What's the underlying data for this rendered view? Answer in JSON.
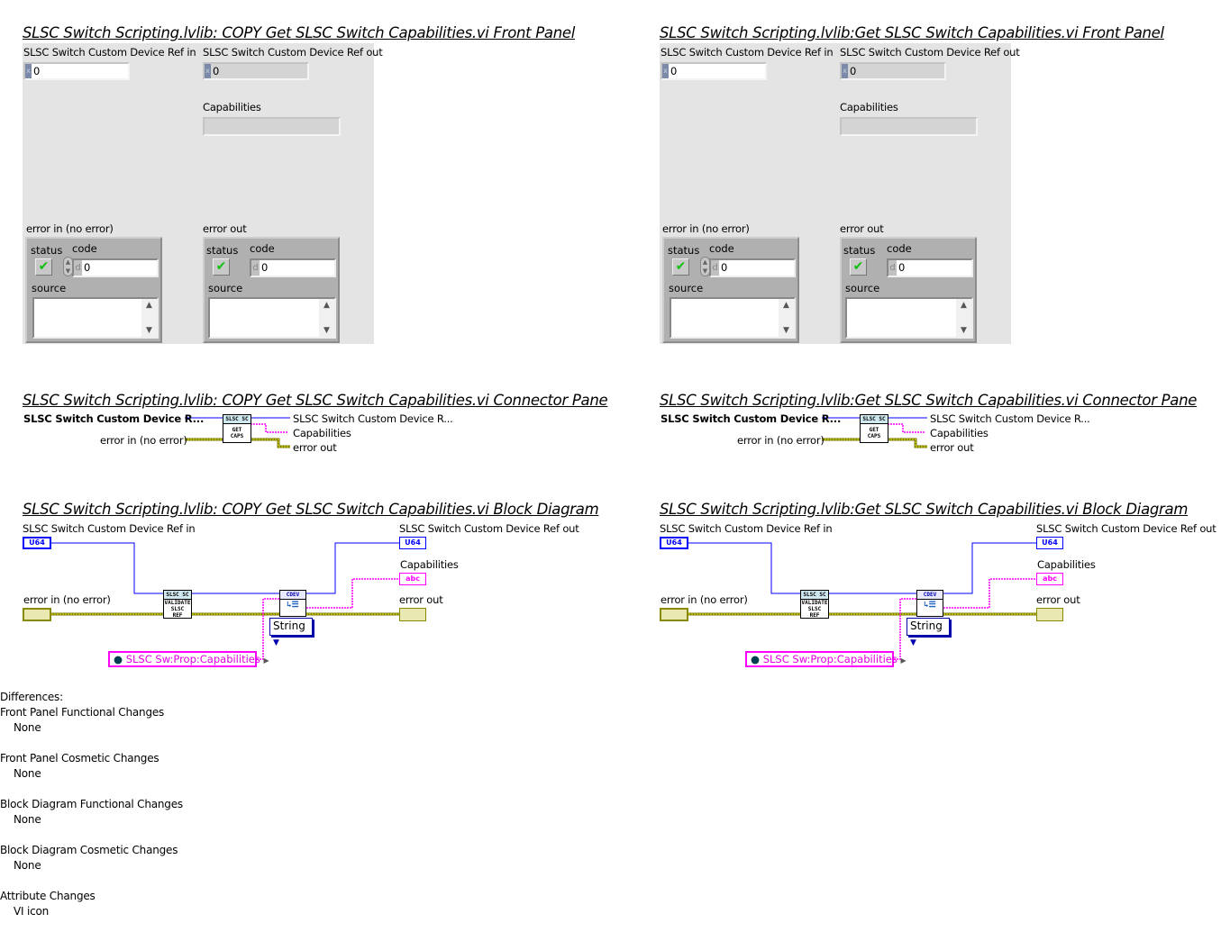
{
  "left": {
    "front_panel_title": "SLSC Switch Scripting.lvlib:  COPY  Get SLSC Switch Capabilities.vi Front Panel",
    "connector_pane_title": "SLSC Switch Scripting.lvlib:  COPY  Get SLSC Switch Capabilities.vi Connector Pane",
    "block_diagram_title": "SLSC Switch Scripting.lvlib:  COPY  Get SLSC Switch Capabilities.vi Block Diagram"
  },
  "right": {
    "front_panel_title": "SLSC Switch Scripting.lvlib:Get SLSC Switch Capabilities.vi Front Panel",
    "connector_pane_title": "SLSC Switch Scripting.lvlib:Get SLSC Switch Capabilities.vi Connector Pane",
    "block_diagram_title": "SLSC Switch Scripting.lvlib:Get SLSC Switch Capabilities.vi Block Diagram"
  },
  "front_panel": {
    "ref_in_label": "SLSC Switch Custom Device Ref in",
    "ref_in_value": "0",
    "ref_out_label": "SLSC Switch Custom Device Ref out",
    "ref_out_value": "0",
    "radix_glyph": "x",
    "capabilities_label": "Capabilities",
    "capabilities_value": "",
    "error_in_label": "error in (no error)",
    "error_out_label": "error out",
    "status_label": "status",
    "code_label": "code",
    "source_label": "source",
    "code_value": "0",
    "code_radix": "d",
    "status_glyph": "✔",
    "scroll_up": "^",
    "scroll_down": "v"
  },
  "connector_pane": {
    "ref_in_label": "SLSC Switch Custom Device R...",
    "error_in_label": "error in (no error)",
    "ref_out_label": "SLSC Switch Custom Device R...",
    "capabilities_label": "Capabilities",
    "error_out_label": "error out",
    "icon_header": "SLSC SC",
    "icon_text_line1": "GET",
    "icon_text_line2": "CAPS"
  },
  "block_diagram": {
    "ref_in_label": "SLSC Switch Custom Device Ref in",
    "error_in_label": "error in (no error)",
    "ref_out_label": "SLSC Switch Custom Device Ref out",
    "capabilities_label": "Capabilities",
    "error_out_label": "error out",
    "u64_tag": "U64",
    "abc_tag": "abc",
    "validate_header": "SLSC SC",
    "validate_line1": "VALIDATE",
    "validate_line2": "SLSC",
    "validate_line3": "REF",
    "cdev_header": "CDEV",
    "type_selector": "String",
    "property_constant": "SLSC Sw:Prop:Capabilities",
    "colors": {
      "u64_wire": "#0000ff",
      "string_wire": "#ff00ff",
      "error_wire": "#8a8a00",
      "error_wire_fill": "#e8e800"
    }
  },
  "differences": {
    "heading": "Differences:",
    "sections": [
      {
        "title": "Front Panel Functional Changes",
        "value": "None"
      },
      {
        "title": "Front Panel Cosmetic Changes",
        "value": "None"
      },
      {
        "title": "Block Diagram Functional Changes",
        "value": "None"
      },
      {
        "title": "Block Diagram Cosmetic Changes",
        "value": "None"
      },
      {
        "title": "Attribute Changes",
        "value": "VI icon"
      }
    ]
  }
}
